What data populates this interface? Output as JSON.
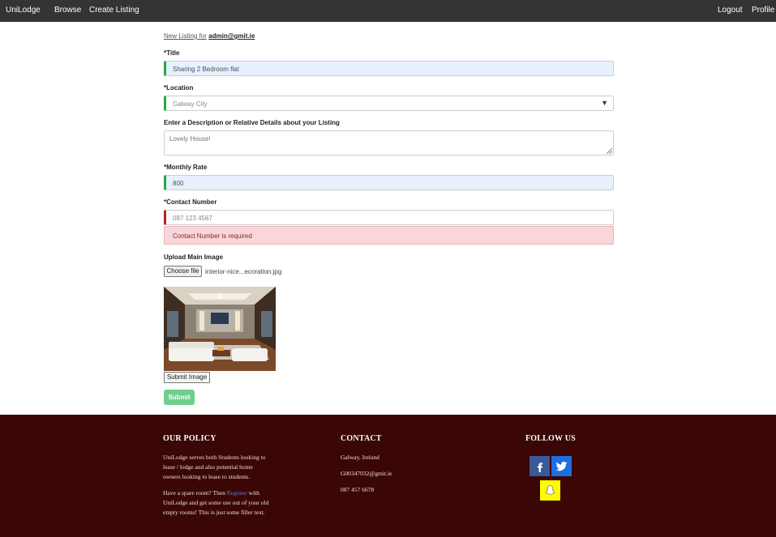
{
  "nav": {
    "brand": "UniLodge",
    "browse": "Browse",
    "create_listing": "Create Listing",
    "logout": "Logout",
    "profile": "Profile"
  },
  "form": {
    "heading_prefix": "New Listing for",
    "user_email": "admin@gmit.ie",
    "title_label": "*Title",
    "title_value": "Sharing 2 Bedroom flat",
    "location_label": "*Location",
    "location_value": "Galway City",
    "description_label": "Enter a Description or Relative Details about your Listing",
    "description_value": "Lovely House!",
    "rate_label": "*Monthly Rate",
    "rate_value": "800",
    "contact_label": "*Contact Number",
    "contact_placeholder": "087 123 4567",
    "contact_error": "Contact Number is required",
    "upload_label": "Upload Main Image",
    "choose_file_label": "Choose file",
    "file_name": "interior-nice...ecoration.jpg",
    "submit_image_label": "Submit Image",
    "submit_label": "Submit"
  },
  "footer": {
    "policy_heading": "OUR POLICY",
    "policy_text_1": "UniLodge serves both Students looking to lease / lodge and also potential home owners looking to lease to students.",
    "policy_text_2_before": "Have a spare room? Then",
    "policy_register_link": "Register",
    "policy_text_2_after": "with UniLodge and get some use out of your old empty rooms! This is just some filler text.",
    "contact_heading": "CONTACT",
    "contact_location": "Galway, Ireland",
    "contact_email": "G00347032@gmit.ie",
    "contact_phone": "087 457 6678",
    "follow_heading": "FOLLOW US"
  },
  "social": [
    "facebook-icon",
    "twitter-icon",
    "snapchat-icon"
  ],
  "colors": {
    "nav_bg": "#343434",
    "footer_bg": "#3a0606",
    "valid": "#28a745",
    "invalid": "#b22222",
    "error_bg": "#f8d7da",
    "submit_bg": "#6fcf8a"
  }
}
